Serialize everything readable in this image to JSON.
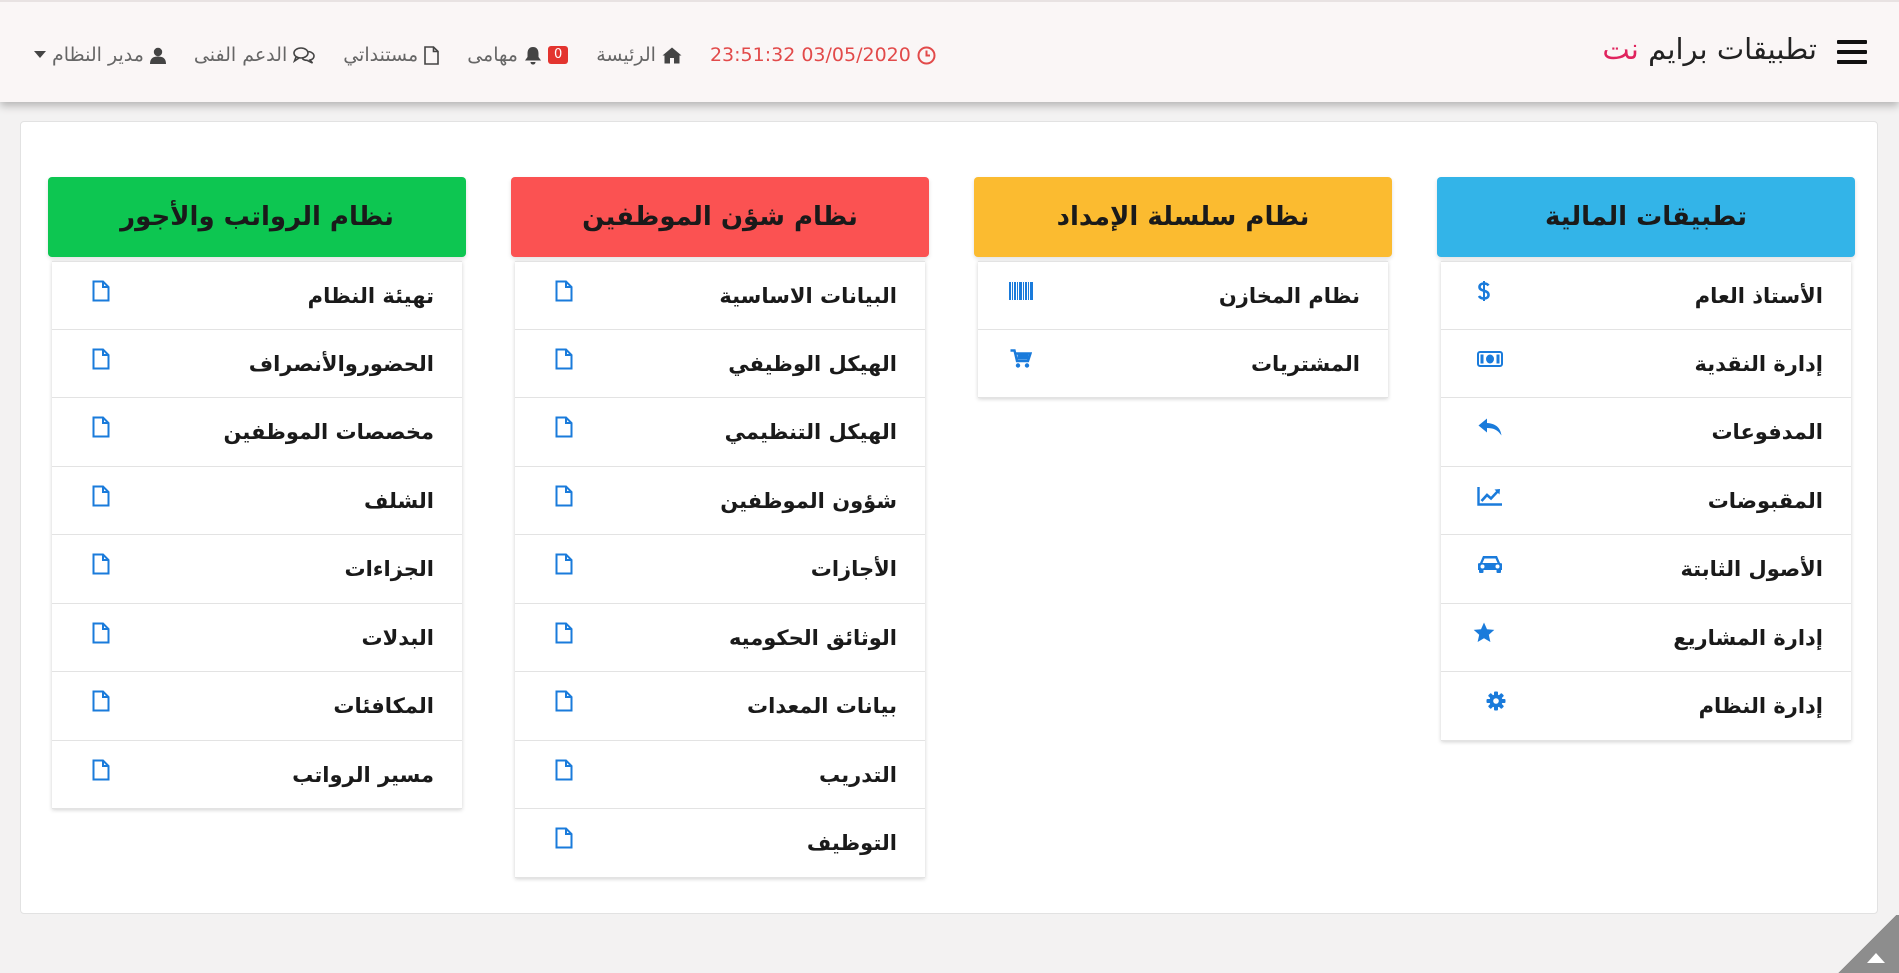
{
  "brand": {
    "title_main": "تطبيقات برايم",
    "title_accent": "نت"
  },
  "nav": {
    "datetime": "23:51:32 03/05/2020",
    "home_label": "الرئيسة",
    "tasks_label": "مهامى",
    "tasks_count": "0",
    "documents_label": "مستنداتي",
    "support_label": "الدعم الفنى",
    "user_label": "مدير النظام"
  },
  "colors": {
    "finance": "#33b4e8",
    "supply": "#fbbb30",
    "hr": "#fb5252",
    "payroll": "#0dc651",
    "icon": "#1a7bdb",
    "accent": "#e0245e",
    "clock": "#e24a4a"
  },
  "columns": [
    {
      "key": "finance",
      "title": "تطبيقات المالية",
      "items": [
        {
          "label": "الأستاذ العام",
          "icon": "dollar-icon"
        },
        {
          "label": "إدارة النقدية",
          "icon": "money-icon"
        },
        {
          "label": "المدفوعات",
          "icon": "reply-icon"
        },
        {
          "label": "المقبوضات",
          "icon": "line-chart-icon"
        },
        {
          "label": "الأصول الثابتة",
          "icon": "car-icon"
        },
        {
          "label": "إدارة المشاريع",
          "icon": "star-icon"
        },
        {
          "label": "إدارة النظام",
          "icon": "gear-icon"
        }
      ]
    },
    {
      "key": "supply",
      "title": "نظام سلسلة الإمداد",
      "items": [
        {
          "label": "نظام المخازن",
          "icon": "barcode-icon"
        },
        {
          "label": "المشتريات",
          "icon": "cart-icon"
        }
      ]
    },
    {
      "key": "hr",
      "title": "نظام شؤن الموظفين",
      "items": [
        {
          "label": "البيانات الاساسية",
          "icon": "file-icon"
        },
        {
          "label": "الهيكل الوظيفي",
          "icon": "file-icon"
        },
        {
          "label": "الهيكل التنظيمي",
          "icon": "file-icon"
        },
        {
          "label": "شؤون الموظفين",
          "icon": "file-icon"
        },
        {
          "label": "الأجازات",
          "icon": "file-icon"
        },
        {
          "label": "الوثائق الحكوميه",
          "icon": "file-icon"
        },
        {
          "label": "بيانات المعدات",
          "icon": "file-icon"
        },
        {
          "label": "التدريب",
          "icon": "file-icon"
        },
        {
          "label": "التوظيف",
          "icon": "file-icon"
        }
      ]
    },
    {
      "key": "payroll",
      "title": "نظام الرواتب والأجور",
      "items": [
        {
          "label": "تهيئة النظام",
          "icon": "file-icon"
        },
        {
          "label": "الحضوروالأنصراف",
          "icon": "file-icon"
        },
        {
          "label": "مخصصات الموظفين",
          "icon": "file-icon"
        },
        {
          "label": "الشلف",
          "icon": "file-icon"
        },
        {
          "label": "الجزاءات",
          "icon": "file-icon"
        },
        {
          "label": "البدلات",
          "icon": "file-icon"
        },
        {
          "label": "المكافئات",
          "icon": "file-icon"
        },
        {
          "label": "مسير الرواتب",
          "icon": "file-icon"
        }
      ]
    }
  ]
}
